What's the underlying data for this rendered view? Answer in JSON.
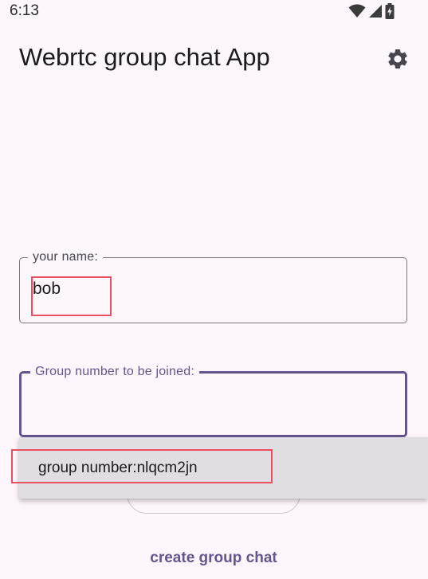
{
  "status_bar": {
    "time": "6:13",
    "icons": [
      "wifi-icon",
      "cellular-signal-icon",
      "battery-charging-icon"
    ]
  },
  "app_bar": {
    "title": "Webrtc group chat App",
    "settings_icon": "gear-icon"
  },
  "name_field": {
    "label": "your name:",
    "value": "bob"
  },
  "group_field": {
    "label": "Group number to be joined:",
    "value": ""
  },
  "autocomplete": {
    "options": [
      "group number:nlqcm2jn"
    ]
  },
  "actions": {
    "create_label": "create group chat"
  },
  "colors": {
    "background": "#fdf7fd",
    "accent": "#65558f",
    "dropdown": "#e1dee3",
    "highlight": "#e8505d"
  }
}
